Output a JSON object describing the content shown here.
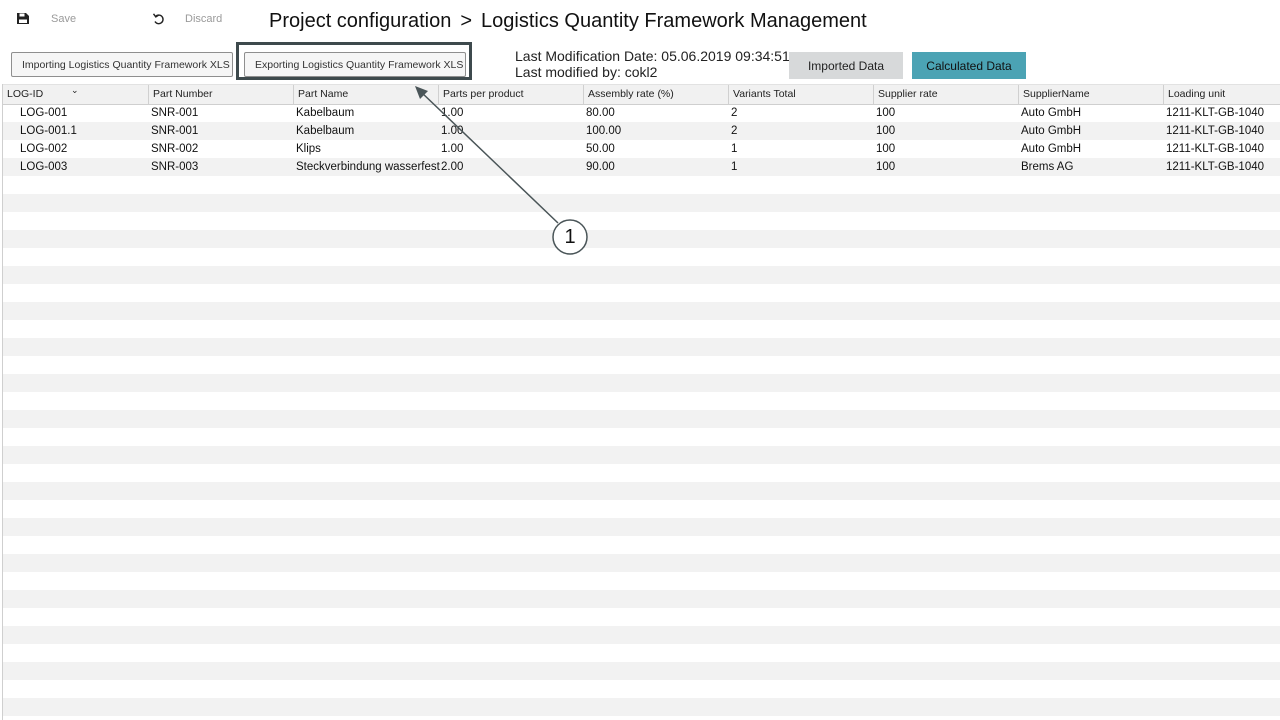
{
  "toolbar": {
    "save_label": "Save",
    "discard_label": "Discard"
  },
  "header": {
    "breadcrumb_root": "Project configuration",
    "separator": ">",
    "page_title": "Logistics Quantity Framework Management"
  },
  "actions": {
    "import_label": "Importing Logistics Quantity Framework XLS",
    "export_label": "Exporting Logistics Quantity Framework XLS"
  },
  "modification": {
    "date_line": "Last Modification Date: 05.06.2019 09:34:51",
    "user_line": "Last modified by: cokl2"
  },
  "views": {
    "imported_label": "Imported Data",
    "calculated_label": "Calculated Data",
    "active_color": "#4ba3b4"
  },
  "table": {
    "columns": [
      "LOG-ID",
      "Part Number",
      "Part Name",
      "Parts per product",
      "Assembly rate (%)",
      "Variants Total",
      "Supplier rate",
      "SupplierName",
      "Loading unit"
    ],
    "rows": [
      [
        "LOG-001",
        "SNR-001",
        "Kabelbaum",
        "1.00",
        "80.00",
        "2",
        "100",
        "Auto GmbH",
        "1211-KLT-GB-1040"
      ],
      [
        "LOG-001.1",
        "SNR-001",
        "Kabelbaum",
        "1.00",
        "100.00",
        "2",
        "100",
        "Auto GmbH",
        "1211-KLT-GB-1040"
      ],
      [
        "LOG-002",
        "SNR-002",
        "Klips",
        "1.00",
        "50.00",
        "1",
        "100",
        "Auto GmbH",
        "1211-KLT-GB-1040"
      ],
      [
        "LOG-003",
        "SNR-003",
        "Steckverbindung wasserfest",
        "2.00",
        "90.00",
        "1",
        "100",
        "Brems AG",
        "1211-KLT-GB-1040"
      ]
    ]
  },
  "callout": {
    "number": "1"
  }
}
